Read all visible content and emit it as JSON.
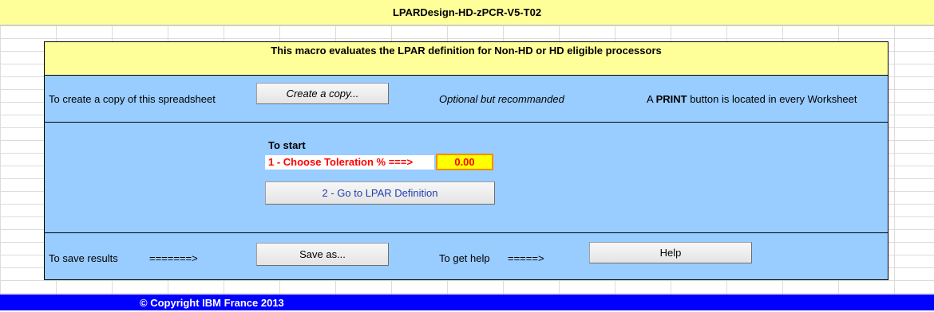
{
  "window": {
    "title": "LPARDesign-HD-zPCR-V5-T02"
  },
  "header": {
    "description": "This macro evaluates the LPAR definition for Non-HD or HD eligible processors"
  },
  "copy_section": {
    "label": "To create a copy of this spreadsheet",
    "button_label": "Create a copy...",
    "note": "Optional but recommanded",
    "print_prefix": "A ",
    "print_bold": "PRINT",
    "print_suffix": " button is located in every Worksheet"
  },
  "start_section": {
    "heading": "To start",
    "toleration_label": "1 - Choose Toleration % ===>",
    "toleration_value": "0.00",
    "lpar_button_label": "2 - Go to LPAR Definition"
  },
  "save_section": {
    "label": "To save results",
    "arrow": "=======>",
    "save_button_label": "Save as...",
    "help_label": "To get help",
    "help_arrow": "=====>",
    "help_button_label": "Help"
  },
  "footer": {
    "copyright": "© Copyright IBM France 2013"
  },
  "colors": {
    "header_yellow": "#ffff99",
    "panel_blue": "#99ccff",
    "footer_blue": "#0000ff",
    "toleration_red": "#ff0000",
    "toleration_highlight": "#ffff00"
  }
}
